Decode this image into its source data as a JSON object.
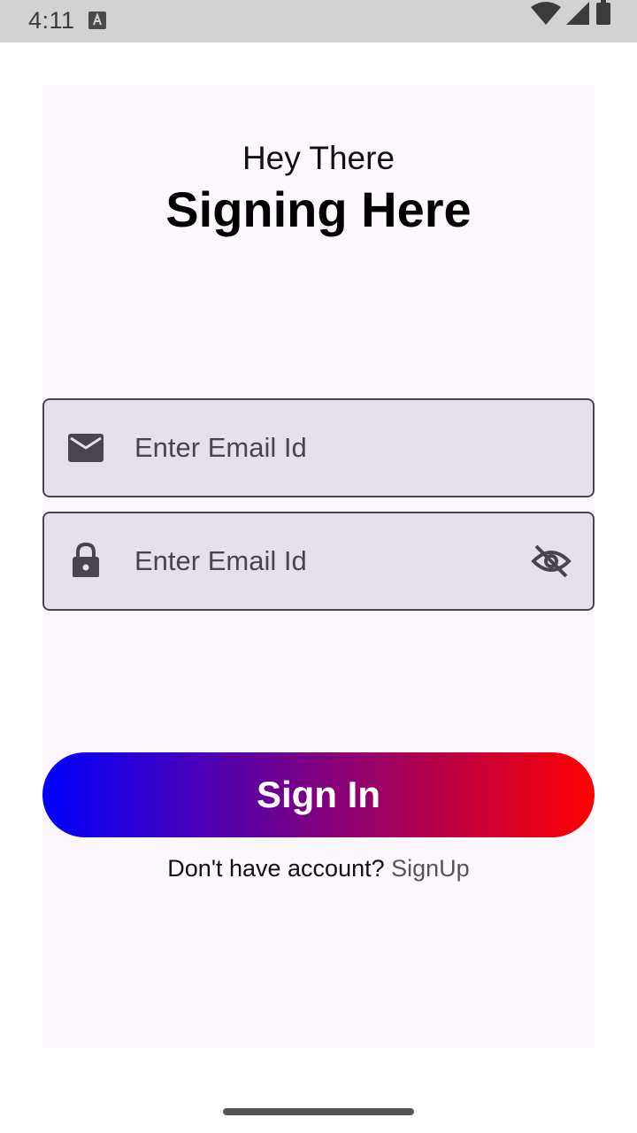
{
  "status_bar": {
    "time": "4:11",
    "icons": [
      "a-notification-icon",
      "wifi-icon",
      "signal-icon",
      "battery-icon"
    ]
  },
  "header": {
    "greeting": "Hey There",
    "title": "Signing Here"
  },
  "form": {
    "email": {
      "placeholder": "Enter Email Id",
      "value": "",
      "icon": "mail-icon"
    },
    "password": {
      "placeholder": "Enter Email Id",
      "value": "",
      "icon": "lock-icon",
      "toggle_icon": "eye-off-icon"
    },
    "submit_label": "Sign In"
  },
  "footer": {
    "prompt": "Don't have account? ",
    "link": "SignUp"
  },
  "colors": {
    "status_bar_bg": "#d2d2d2",
    "card_bg": "#fdf8fd",
    "field_bg": "#e6e0ea",
    "gradient_start": "#0000ff",
    "gradient_end": "#ff0000"
  }
}
